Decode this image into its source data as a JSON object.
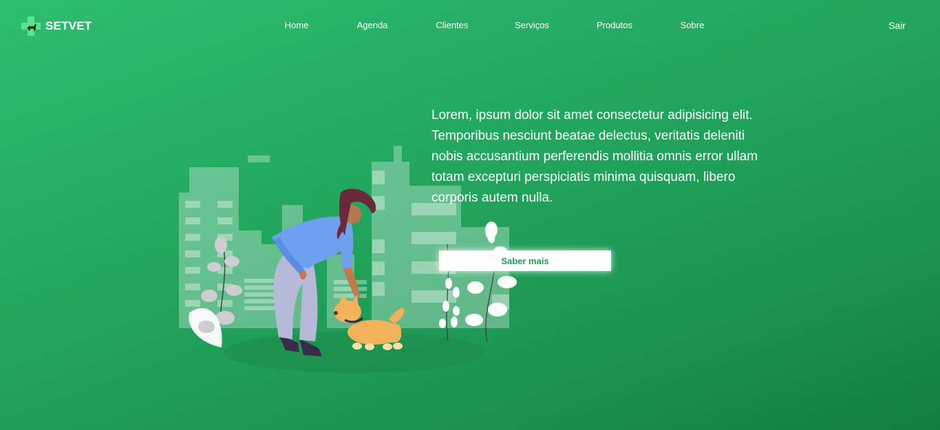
{
  "brand": {
    "name": "SETVET",
    "logo_icon": "vet-cross-dog-icon"
  },
  "nav": {
    "items": [
      {
        "label": "Home"
      },
      {
        "label": "Agenda"
      },
      {
        "label": "Clientes"
      },
      {
        "label": "Serviços"
      },
      {
        "label": "Produtos"
      },
      {
        "label": "Sobre"
      }
    ],
    "logout_label": "Sair"
  },
  "hero": {
    "text": "Lorem, ipsum dolor sit amet consectetur adipisicing elit. Temporibus nesciunt beatae delectus, veritatis deleniti nobis accusantium perferendis mollitia omnis error ullam totam excepturi perspiciatis minima quisquam, libero corporis autem nulla.",
    "button_label": "Saber mais",
    "illustration": "woman-petting-dog-city-illustration"
  },
  "colors": {
    "background_start": "#2ebd70",
    "background_end": "#137d3f",
    "button_text": "#1f9e55",
    "logo_cross": "#5be38f"
  }
}
